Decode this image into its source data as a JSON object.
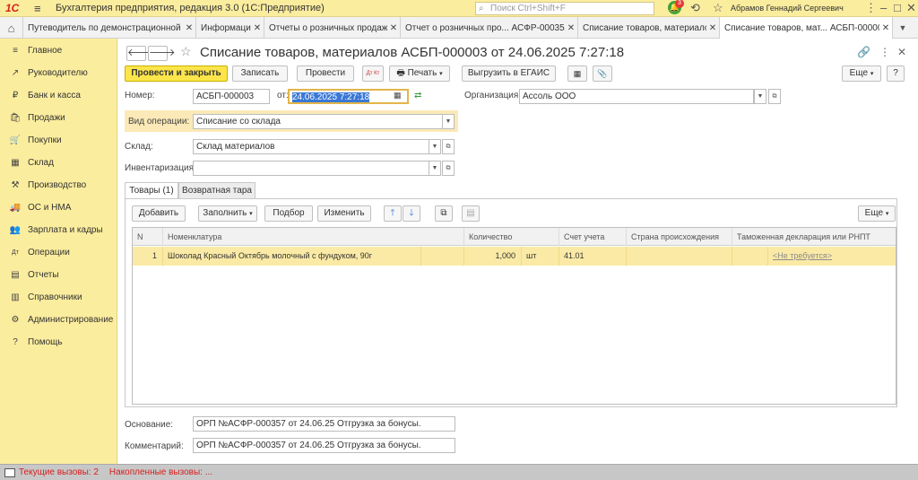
{
  "titlebar": {
    "logo": "1С",
    "title": "Бухгалтерия предприятия, редакция 3.0  (1С:Предприятие)",
    "search_placeholder": "Поиск Ctrl+Shift+F",
    "notification_count": "3",
    "user": "Абрамов Геннадий Сергеевич"
  },
  "tabs": [
    {
      "label": "Путеводитель по демонстрационной ..."
    },
    {
      "label": "Информация"
    },
    {
      "label": "Отчеты о розничных продажах"
    },
    {
      "label": "Отчет о розничных про...  АСФР-000358"
    },
    {
      "label": "Списание товаров, материалов"
    },
    {
      "label": "Списание товаров, мат...  АСБП-000003"
    }
  ],
  "sidebar": {
    "items": [
      {
        "label": "Главное",
        "icon": "≡"
      },
      {
        "label": "Руководителю",
        "icon": "↗"
      },
      {
        "label": "Банк и касса",
        "icon": "₽"
      },
      {
        "label": "Продажи",
        "icon": "🛍"
      },
      {
        "label": "Покупки",
        "icon": "🛒"
      },
      {
        "label": "Склад",
        "icon": "▦"
      },
      {
        "label": "Производство",
        "icon": "⚒"
      },
      {
        "label": "ОС и НМА",
        "icon": "🚚"
      },
      {
        "label": "Зарплата и кадры",
        "icon": "👥"
      },
      {
        "label": "Операции",
        "icon": "Дт"
      },
      {
        "label": "Отчеты",
        "icon": "▤"
      },
      {
        "label": "Справочники",
        "icon": "▥"
      },
      {
        "label": "Администрирование",
        "icon": "⚙"
      },
      {
        "label": "Помощь",
        "icon": "?"
      }
    ]
  },
  "document": {
    "title": "Списание товаров, материалов АСБП-000003 от 24.06.2025 7:27:18",
    "toolbar": {
      "post_close": "Провести и закрыть",
      "save": "Записать",
      "post": "Провести",
      "dt_kt": "Дт Кт",
      "print": "Печать",
      "egais": "Выгрузить в ЕГАИС",
      "more": "Еще",
      "help": "?"
    },
    "number_label": "Номер:",
    "number_value": "АСБП-000003",
    "date_label": "от:",
    "date_value": "24.06.2025  7:27:18",
    "org_label": "Организация:",
    "org_value": "Ассоль ООО",
    "operation_label": "Вид операции:",
    "operation_value": "Списание со склада",
    "warehouse_label": "Склад:",
    "warehouse_value": "Склад материалов",
    "inventory_label": "Инвентаризация:",
    "inventory_value": "",
    "basis_label": "Основание:",
    "basis_value": "ОРП №АСФР-000357 от 24.06.25 Отгрузка за бонусы.",
    "comment_label": "Комментарий:",
    "comment_value": "ОРП №АСФР-000357 от 24.06.25 Отгрузка за бонусы."
  },
  "subtabs": [
    {
      "label": "Товары (1)"
    },
    {
      "label": "Возвратная тара"
    }
  ],
  "table_toolbar": {
    "add": "Добавить",
    "fill": "Заполнить",
    "pick": "Подбор",
    "change": "Изменить",
    "more": "Еще"
  },
  "table": {
    "headers": [
      "N",
      "Номенклатура",
      "Количество",
      "Счет учета",
      "Страна происхождения",
      "Таможенная декларация или РНПТ"
    ],
    "rows": [
      {
        "n": "1",
        "item": "Шоколад Красный Октябрь молочный с фундуком, 90г",
        "qty": "1,000",
        "unit": "шт",
        "account": "41.01",
        "country": "",
        "customs": "<Не требуется>"
      }
    ]
  },
  "statusbar": {
    "current_calls": "Текущие вызовы: 2",
    "accumulated_calls": "Накопленные вызовы: ..."
  }
}
